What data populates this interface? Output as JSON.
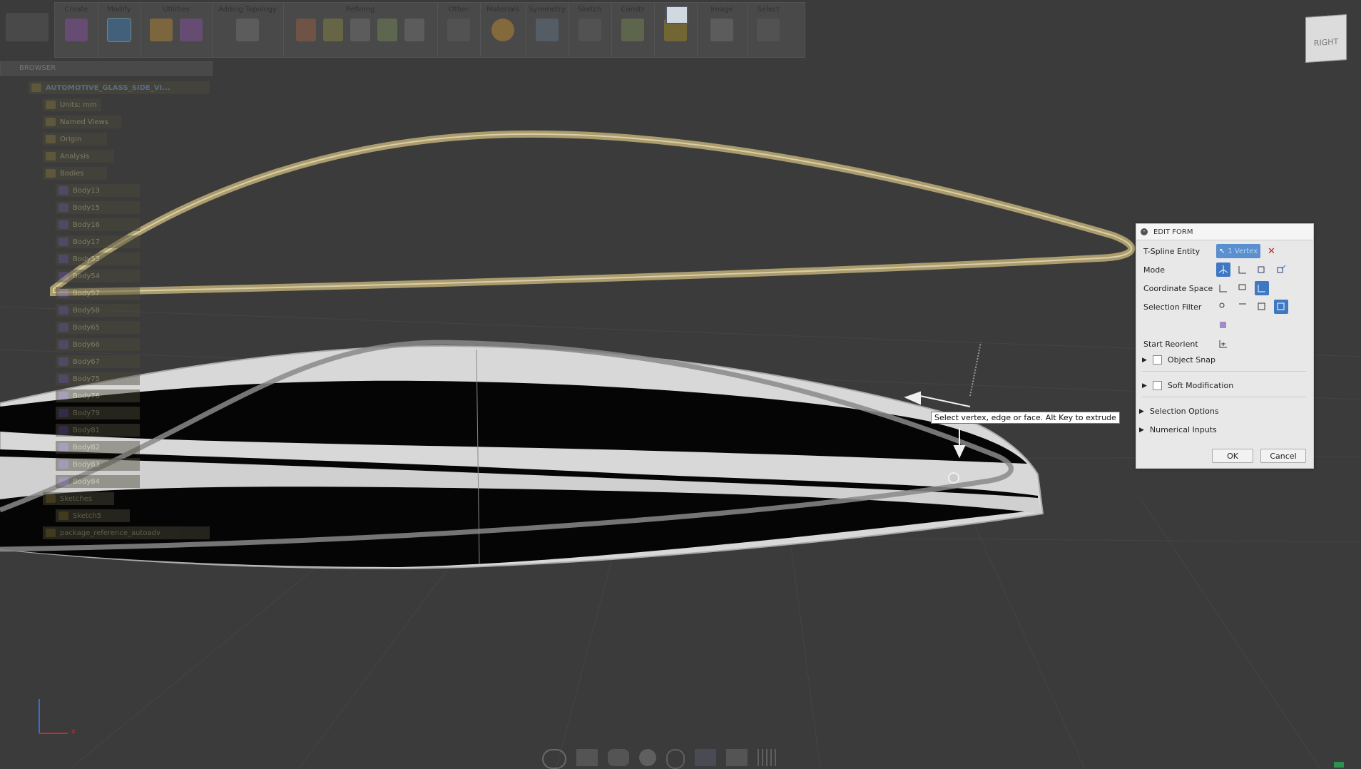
{
  "toolbar": {
    "groups": [
      {
        "label": "Create"
      },
      {
        "label": "Modify"
      },
      {
        "label": "Utilities"
      },
      {
        "label": "Adding Topology"
      },
      {
        "label": "Refining"
      },
      {
        "label": "Other"
      },
      {
        "label": "Materials"
      },
      {
        "label": "Symmetry"
      },
      {
        "label": "Sketch"
      },
      {
        "label": "Constr"
      },
      {
        "label": "spect"
      },
      {
        "label": "Image"
      },
      {
        "label": "Select"
      }
    ]
  },
  "viewcube": {
    "face": "RIGHT"
  },
  "browser": {
    "title": "BROWSER",
    "root": "AUTOMOTIVE_GLASS_SIDE_VI...",
    "items": [
      {
        "label": "Units: mm"
      },
      {
        "label": "Named Views"
      },
      {
        "label": "Origin"
      },
      {
        "label": "Analysis"
      },
      {
        "label": "Bodies"
      }
    ],
    "bodies": [
      {
        "label": "Body13"
      },
      {
        "label": "Body15"
      },
      {
        "label": "Body16"
      },
      {
        "label": "Body17"
      },
      {
        "label": "Body53"
      },
      {
        "label": "Body54"
      },
      {
        "label": "Body57"
      },
      {
        "label": "Body58"
      },
      {
        "label": "Body65"
      },
      {
        "label": "Body66"
      },
      {
        "label": "Body67"
      },
      {
        "label": "Body75"
      },
      {
        "label": "Body76"
      },
      {
        "label": "Body79"
      },
      {
        "label": "Body81"
      },
      {
        "label": "Body82"
      },
      {
        "label": "Body83"
      },
      {
        "label": "Body84"
      }
    ],
    "tail": [
      {
        "label": "Sketches"
      },
      {
        "label": "Sketch5"
      },
      {
        "label": "package_reference_autoadv"
      }
    ]
  },
  "edit_form": {
    "title": "EDIT FORM",
    "tspline_label": "T-Spline Entity",
    "tspline_value": "1 Vertex",
    "mode_label": "Mode",
    "coord_label": "Coordinate Space",
    "filter_label": "Selection Filter",
    "reorient_label": "Start Reorient",
    "object_snap": "Object Snap",
    "soft_mod": "Soft Modification",
    "selection_options": "Selection Options",
    "numerical_inputs": "Numerical Inputs",
    "ok": "OK",
    "cancel": "Cancel"
  },
  "tooltip": "Select vertex, edge or face. Alt Key to extrude",
  "axis": {
    "x": "x"
  },
  "colors": {
    "viewport": "#3b3b3b",
    "accent": "#3f78c2",
    "highlight": "#c9b476"
  }
}
